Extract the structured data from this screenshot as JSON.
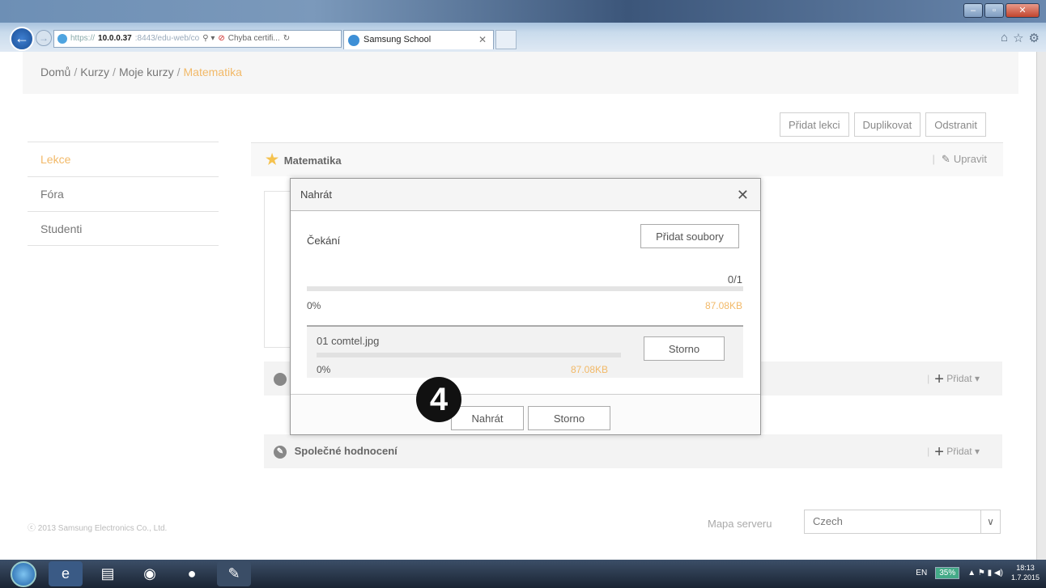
{
  "browser": {
    "url_scheme": "https://",
    "url_host": "10.0.0.37",
    "url_rest": ":8443/edu-web/co",
    "cert_error": "Chyba certifi...",
    "tab_title": "Samsung School"
  },
  "breadcrumb": {
    "items": [
      "Domů",
      "Kurzy",
      "Moje kurzy"
    ],
    "current": "Matematika"
  },
  "actions": {
    "add_lesson": "Přidat lekci",
    "duplicate": "Duplikovat",
    "remove": "Odstranit"
  },
  "sidebar": {
    "items": [
      {
        "label": "Lekce"
      },
      {
        "label": "Fóra"
      },
      {
        "label": "Studenti"
      }
    ]
  },
  "course": {
    "title": "Matematika",
    "edit": "Upravit"
  },
  "sections": [
    {
      "title": "",
      "add": "Přidat"
    },
    {
      "title": "Společné hodnocení",
      "add": "Přidat"
    }
  ],
  "footer": {
    "copyright": "ⓒ 2013 Samsung Electronics Co., Ltd.",
    "sitemap": "Mapa serveru",
    "language": "Czech"
  },
  "modal": {
    "title": "Nahrát",
    "status": "Čekání",
    "add_files": "Přidat soubory",
    "count": "0/1",
    "percent": "0%",
    "progress_fraction": 0,
    "size": "87.08KB",
    "file": {
      "name": "01 comtel.jpg",
      "percent": "0%",
      "progress_fraction": 0,
      "size": "87.08KB",
      "cancel": "Storno"
    },
    "upload": "Nahrát",
    "cancel": "Storno"
  },
  "step_badge": "4",
  "taskbar": {
    "lang": "EN",
    "battery": "35%",
    "time": "18:13",
    "date": "1.7.2015"
  },
  "colors": {
    "accent": "#f2b968",
    "page_bg": "#ffffff"
  }
}
